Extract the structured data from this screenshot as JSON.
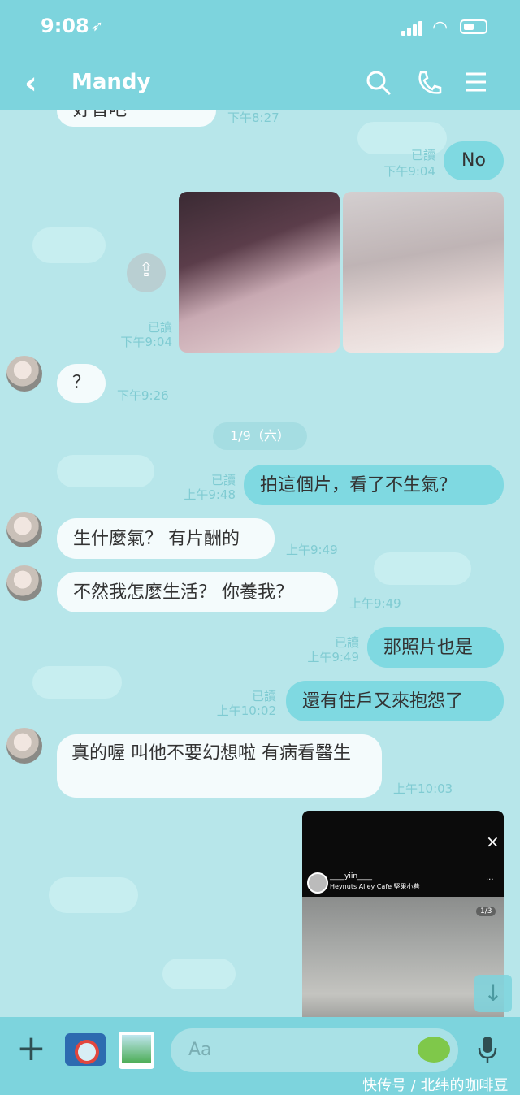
{
  "status": {
    "time": "9:08",
    "location_glyph": "➶"
  },
  "header": {
    "title": "Mandy",
    "back_icon": "chevron-left-icon",
    "icons": [
      "search-icon",
      "phone-icon",
      "menu-icon"
    ]
  },
  "messages": [
    {
      "id": "m0",
      "side": "in",
      "text": "好音吧",
      "time": "下午8:27"
    },
    {
      "id": "m1",
      "side": "out",
      "text": "No",
      "read": "已讀",
      "time": "下午9:04"
    },
    {
      "id": "m2",
      "side": "out",
      "type": "photos",
      "read": "已讀",
      "time": "下午9:04"
    },
    {
      "id": "m3",
      "side": "in",
      "text": "？",
      "time": "下午9:26"
    },
    {
      "id": "m4",
      "side": "out",
      "text": "拍這個片，看了不生氣？",
      "read": "已讀",
      "time": "上午9:48"
    },
    {
      "id": "m5",
      "side": "in",
      "text": "生什麼氣？ 有片酬的",
      "time": "上午9:49"
    },
    {
      "id": "m6",
      "side": "in",
      "text": "不然我怎麼生活？ 你養我？",
      "time": "上午9:49"
    },
    {
      "id": "m7",
      "side": "out",
      "text": "那照片也是",
      "read": "已讀",
      "time": "上午9:49"
    },
    {
      "id": "m8",
      "side": "out",
      "text": "還有住戶又來抱怨了",
      "read": "已讀",
      "time": "上午10:02"
    },
    {
      "id": "m9",
      "side": "in",
      "text": "真的喔 叫他不要幻想啦 有病看醫生",
      "time": "上午10:03"
    }
  ],
  "date_separator": "1/9（六）",
  "story": {
    "user": "____yiin____",
    "place": "Heynuts Alley Cafe 堅果小巷",
    "counter": "1/3",
    "close": "×",
    "more": "···"
  },
  "input": {
    "placeholder": "Aa"
  },
  "watermark": "快传号 / 北纬的咖啡豆",
  "colors": {
    "header": "#7dd4dd",
    "outgoing": "#7fd9e1",
    "incoming": "#f4fbfc",
    "background": "#b7e6ea"
  }
}
